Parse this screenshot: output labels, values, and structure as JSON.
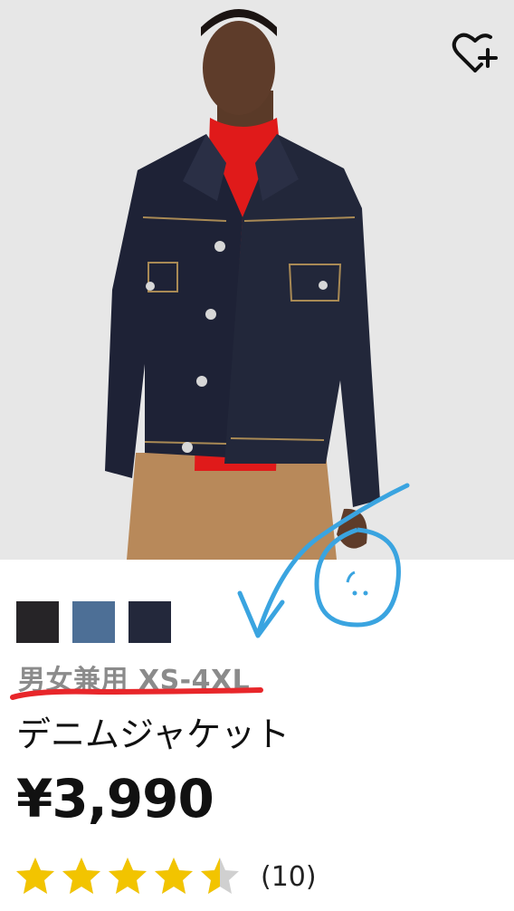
{
  "product": {
    "gender_size": "男女兼用 XS-4XL",
    "name": "デニムジャケット",
    "price": "¥3,990",
    "rating": {
      "value": 4.5,
      "max": 5,
      "count_text": "(10)"
    },
    "color_swatches": [
      {
        "name": "black",
        "color": "#262427"
      },
      {
        "name": "blue",
        "color": "#4d6f96"
      },
      {
        "name": "navy",
        "color": "#23283b"
      }
    ]
  },
  "icons": {
    "favorite": "heart-plus-icon",
    "star": "star-icon"
  },
  "colors": {
    "star": "#f2c400",
    "star_empty": "#d0d0d0",
    "annotation_red": "#e8262a",
    "annotation_blue": "#3aa4e0"
  }
}
